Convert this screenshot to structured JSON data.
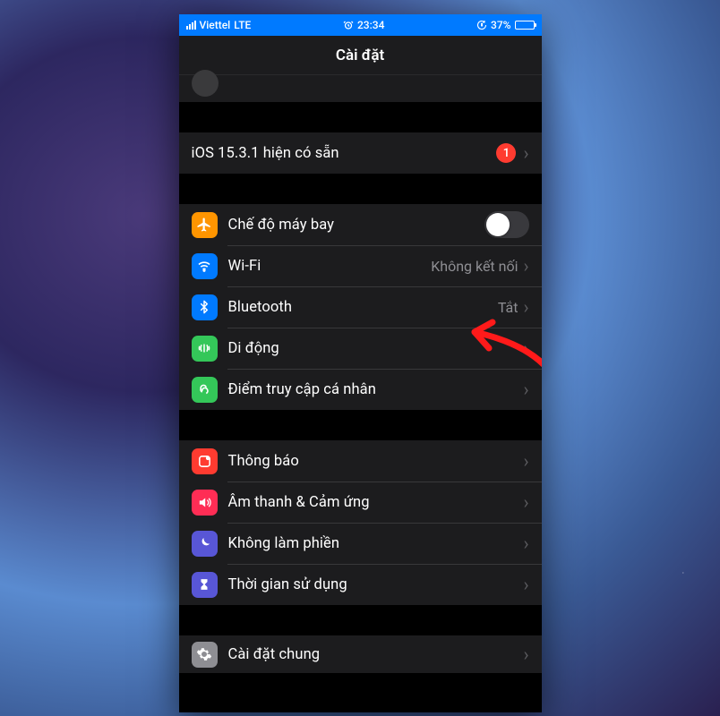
{
  "status_bar": {
    "carrier": "Viettel",
    "network": "LTE",
    "time": "23:34",
    "battery_pct": "37%",
    "alarm": true
  },
  "header": {
    "title": "Cài đặt"
  },
  "update": {
    "label": "iOS 15.3.1 hiện có sẵn",
    "badge": "1"
  },
  "rows": {
    "airplane": "Chế độ máy bay",
    "wifi": "Wi-Fi",
    "wifi_value": "Không kết nối",
    "bluetooth": "Bluetooth",
    "bluetooth_value": "Tắt",
    "cellular": "Di động",
    "hotspot": "Điểm truy cập cá nhân",
    "notifications": "Thông báo",
    "sounds": "Âm thanh & Cảm ứng",
    "dnd": "Không làm phiền",
    "screentime": "Thời gian sử dụng",
    "general": "Cài đặt chung"
  },
  "annotation": {
    "arrow_color": "#ff1a1a"
  }
}
